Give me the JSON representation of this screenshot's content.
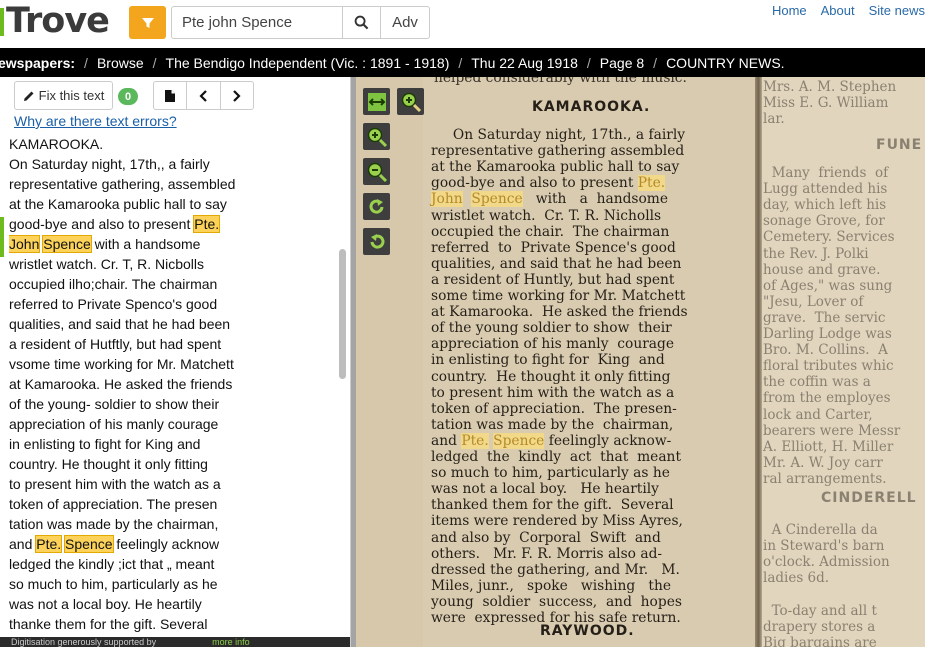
{
  "header": {
    "logo": "Trove",
    "search_value": "Pte john Spence",
    "adv_label": "Adv",
    "links": [
      "Home",
      "About",
      "Site news"
    ]
  },
  "breadcrumb": [
    "ewspapers:",
    "Browse",
    "The Bendigo Independent (Vic. : 1891 - 1918)",
    "Thu 22 Aug 1918",
    "Page 8",
    "COUNTRY NEWS."
  ],
  "text_panel": {
    "fix_label": "Fix this text",
    "fix_count": "0",
    "why_link": "Why are there text errors?",
    "lines": [
      [
        {
          "t": "KAMAROOKA."
        }
      ],
      [
        {
          "t": "On Saturday night, 17th,, a fairly"
        }
      ],
      [
        {
          "t": "representative gathering, assembled"
        }
      ],
      [
        {
          "t": "at the Kamarooka public hall to say"
        }
      ],
      [
        {
          "t": "good-bye and also to present "
        },
        {
          "t": "Pte.",
          "h": true
        }
      ],
      [
        {
          "t": "John",
          "h": true
        },
        {
          "t": " "
        },
        {
          "t": "Spence",
          "h": true
        },
        {
          "t": " with a handsome"
        }
      ],
      [
        {
          "t": "wristlet watch. Cr. T, R. Nicbolls"
        }
      ],
      [
        {
          "t": "occupied ilho;chair. The chairman"
        }
      ],
      [
        {
          "t": "referred to Private Spenco's good"
        }
      ],
      [
        {
          "t": "qualities, and said that he had been"
        }
      ],
      [
        {
          "t": "a resident of Hutftly, but had spent"
        }
      ],
      [
        {
          "t": "vsome time working for Mr. Matchett"
        }
      ],
      [
        {
          "t": "at Kamarooka. He asked the friends"
        }
      ],
      [
        {
          "t": "of the young- soldier to show their"
        }
      ],
      [
        {
          "t": "appreciation of his manly courage"
        }
      ],
      [
        {
          "t": "in enlisting to fight for King and"
        }
      ],
      [
        {
          "t": "country. He thought it only fitting"
        }
      ],
      [
        {
          "t": "to present him with the watch as a"
        }
      ],
      [
        {
          "t": "token of appreciation. The presen"
        }
      ],
      [
        {
          "t": "tation was made by the chairman,"
        }
      ],
      [
        {
          "t": "and "
        },
        {
          "t": "Pte.",
          "h": true
        },
        {
          "t": " "
        },
        {
          "t": "Spence",
          "h": true
        },
        {
          "t": " feelingly acknow"
        }
      ],
      [
        {
          "t": "ledged the kindly ;ict that „ meant"
        }
      ],
      [
        {
          "t": "so much to him, particularly as he"
        }
      ],
      [
        {
          "t": "was not a local boy. He heartily"
        }
      ],
      [
        {
          "t": "thanke them for the gift. Several"
        }
      ]
    ],
    "footer": "Digitisation generously supported by",
    "footer_more": "more info"
  },
  "viewer": {
    "top_fragment": "helped considerably with the music.",
    "heading": "KAMAROOKA.",
    "lines": [
      [
        {
          "t": "     On Saturday night, 17th., a fairly"
        }
      ],
      [
        {
          "t": "representative gathering assembled"
        }
      ],
      [
        {
          "t": "at the Kamarooka public hall to say"
        }
      ],
      [
        {
          "t": "good-bye and also to present "
        },
        {
          "t": "Pte.",
          "h": true
        }
      ],
      [
        {
          "t": "John",
          "h": true
        },
        {
          "t": "  "
        },
        {
          "t": "Spence",
          "h": true
        },
        {
          "t": "   with   a  handsome"
        }
      ],
      [
        {
          "t": "wristlet watch.  Cr. T. R. Nicholls"
        }
      ],
      [
        {
          "t": "occupied the chair.  The chairman"
        }
      ],
      [
        {
          "t": "referred  to  Private Spence's good"
        }
      ],
      [
        {
          "t": "qualities, and said that he had been"
        }
      ],
      [
        {
          "t": "a resident of Huntly, but had spent"
        }
      ],
      [
        {
          "t": "some time working for Mr. Matchett"
        }
      ],
      [
        {
          "t": "at Kamarooka.  He asked the friends"
        }
      ],
      [
        {
          "t": "of the young soldier to show  their"
        }
      ],
      [
        {
          "t": "appreciation of his manly  courage"
        }
      ],
      [
        {
          "t": "in enlisting to fight for  King  and"
        }
      ],
      [
        {
          "t": "country.  He thought it only fitting"
        }
      ],
      [
        {
          "t": "to present him with the watch as a"
        }
      ],
      [
        {
          "t": "token of appreciation.  The presen-"
        }
      ],
      [
        {
          "t": "tation was made by the  chairman,"
        }
      ],
      [
        {
          "t": "and "
        },
        {
          "t": "Pte.",
          "h": true
        },
        {
          "t": " "
        },
        {
          "t": "Spence",
          "h": true
        },
        {
          "t": " feelingly acknow-"
        }
      ],
      [
        {
          "t": "ledged  the  kindly  act  that  meant"
        }
      ],
      [
        {
          "t": "so much to him, particularly as he"
        }
      ],
      [
        {
          "t": "was not a local boy.   He heartily"
        }
      ],
      [
        {
          "t": "thanked them for the gift.  Several"
        }
      ],
      [
        {
          "t": "items were rendered by Miss Ayres,"
        }
      ],
      [
        {
          "t": "and also by  Corporal  Swift  and"
        }
      ],
      [
        {
          "t": "others.   Mr. F. R. Morris also ad-"
        }
      ],
      [
        {
          "t": "dressed the gathering, and Mr.   M."
        }
      ],
      [
        {
          "t": "Miles, junr.,   spoke   wishing   the"
        }
      ],
      [
        {
          "t": "young  soldier  success,  and  hopes"
        }
      ],
      [
        {
          "t": "were  expressed for his safe return."
        }
      ]
    ],
    "bottom_heading": "RAYWOOD.",
    "right_col": {
      "top_lines": [
        "Mrs. A. M. Stephen",
        "Miss E. G. William",
        "lar."
      ],
      "heading1": "FUNE",
      "mid_lines": [
        "  Many  friends  of",
        "Lugg attended his",
        "day, which left his",
        "sonage Grove, for",
        "Cemetery. Services",
        "the Rev. J. Polki",
        "house and grave.",
        "of Ages,\" was sung",
        "\"Jesu, Lover of",
        "grave.  The servic",
        "Darling Lodge was",
        "Bro. M. Collins.  A",
        "floral tributes whic",
        "the coffin was a",
        "from the employes",
        "lock and Carter,",
        "bearers were Messr",
        "A. Elliott, H. Miller",
        "Mr. A. W. Joy carr",
        "ral arrangements."
      ],
      "heading2": "CINDERELL",
      "bottom_lines": [
        "  A Cinderella da",
        "in Steward's barn",
        "o'clock. Admission",
        "ladies 6d.",
        "",
        "  To-day and all t",
        "drapery stores a",
        "Big bargains are"
      ]
    }
  },
  "colors": {
    "accent_orange": "#f3a51d",
    "accent_green": "#6dbb1f",
    "highlight": "#fcd25a",
    "link": "#2a6aa8"
  },
  "icons": [
    "filter-icon",
    "search-icon",
    "pencil-icon",
    "document-icon",
    "chevron-left-icon",
    "chevron-right-icon",
    "fit-width-icon",
    "zoom-select-icon",
    "zoom-in-icon",
    "zoom-out-icon",
    "rotate-right-icon",
    "rotate-left-icon"
  ]
}
